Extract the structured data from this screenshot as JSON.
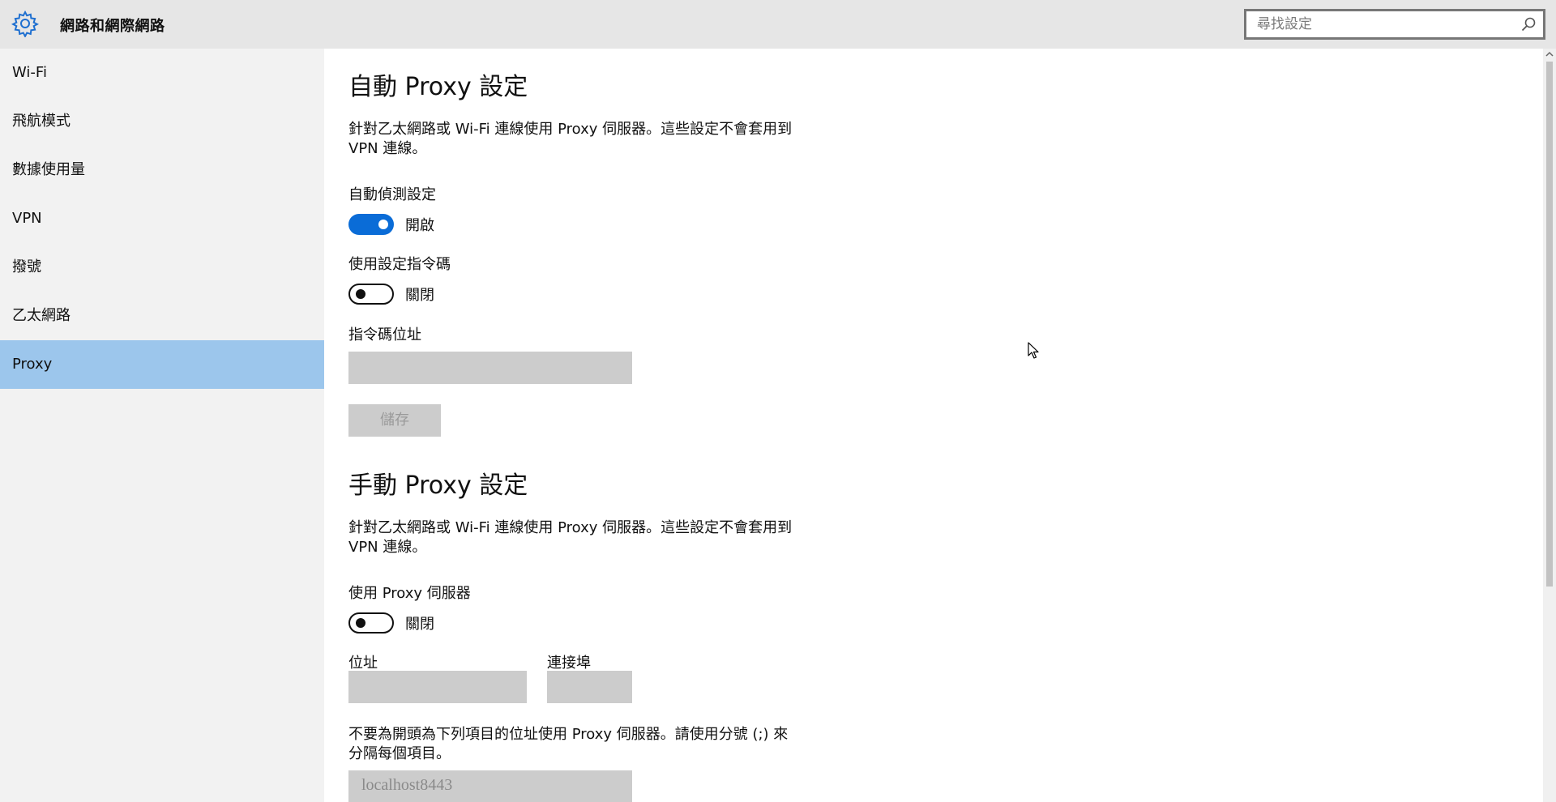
{
  "header": {
    "title": "網路和網際網路",
    "search_placeholder": "尋找設定"
  },
  "sidebar": {
    "items": [
      {
        "label": "Wi-Fi"
      },
      {
        "label": "飛航模式"
      },
      {
        "label": "數據使用量"
      },
      {
        "label": "VPN"
      },
      {
        "label": "撥號"
      },
      {
        "label": "乙太網路"
      },
      {
        "label": "Proxy",
        "active": true
      }
    ]
  },
  "auto_proxy": {
    "title": "自動 Proxy 設定",
    "description": "針對乙太網路或 Wi-Fi 連線使用 Proxy 伺服器。這些設定不會套用到 VPN 連線。",
    "auto_detect_label": "自動偵測設定",
    "auto_detect_state": "開啟",
    "use_script_label": "使用設定指令碼",
    "use_script_state": "關閉",
    "script_address_label": "指令碼位址",
    "script_address_value": "",
    "save_label": "儲存"
  },
  "manual_proxy": {
    "title": "手動 Proxy 設定",
    "description": "針對乙太網路或 Wi-Fi 連線使用 Proxy 伺服器。這些設定不會套用到 VPN 連線。",
    "use_proxy_label": "使用 Proxy 伺服器",
    "use_proxy_state": "關閉",
    "address_label": "位址",
    "address_value": "",
    "port_label": "連接埠",
    "port_value": "",
    "exceptions_description": "不要為開頭為下列項目的位址使用 Proxy 伺服器。請使用分號 (;) 來分隔每個項目。",
    "exceptions_value": "localhost8443"
  },
  "colors": {
    "accent": "#0a6cd7",
    "selected_nav": "#9cc6ec",
    "header_bg": "#e6e6e6",
    "sidebar_bg": "#f2f2f2",
    "disabled_field": "#cccccc"
  },
  "icons": {
    "app": "gear-icon",
    "search": "search-icon",
    "scroll_up": "chevron-up-icon",
    "cursor": "mouse-cursor-icon"
  }
}
